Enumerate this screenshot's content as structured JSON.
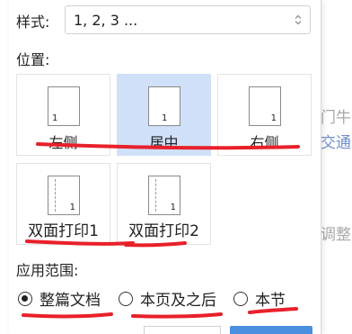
{
  "style_row": {
    "label": "样式:",
    "value": "1, 2, 3 ..."
  },
  "position_label": "位置:",
  "position_tiles": [
    {
      "label": "左侧",
      "page_number": "1",
      "selected": false
    },
    {
      "label": "居中",
      "page_number": "1",
      "selected": true
    },
    {
      "label": "右侧",
      "page_number": "1",
      "selected": false
    },
    {
      "label": "双面打印1",
      "page_number": "1",
      "selected": false
    },
    {
      "label": "双面打印2",
      "page_number": "1",
      "selected": false
    }
  ],
  "scope_label": "应用范围:",
  "scope_options": [
    {
      "label": "整篇文档",
      "checked": true
    },
    {
      "label": "本页及之后",
      "checked": false
    },
    {
      "label": "本节",
      "checked": false
    }
  ],
  "background_fragments": [
    "门牛",
    "交通",
    "调整"
  ],
  "colors": {
    "selected_tile": "#cfe0f8",
    "annotation": "#e8202a",
    "primary_button": "#4a8fe0"
  },
  "icons": {
    "style_select": "chevron-updown-icon",
    "page_preview": "page-icon",
    "radio": "radio-button-icon"
  }
}
